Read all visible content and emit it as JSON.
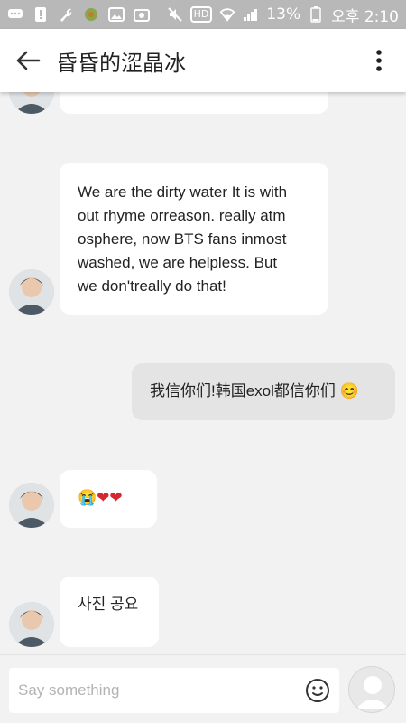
{
  "status_bar": {
    "battery": "13%",
    "time": "오후 2:10",
    "network_badge": "HD"
  },
  "header": {
    "title": "昏昏的涩晶冰"
  },
  "messages": [
    {
      "direction": "in",
      "text": "..."
    },
    {
      "direction": "in",
      "text": "We are the dirty water It is with\nout rhyme orreason. really atm\nosphere, now BTS fans inmost\nwashed, we are helpless. But\nwe don'treally do that!"
    },
    {
      "direction": "out",
      "text": "我信你们!韩国exol都信你们 😊"
    },
    {
      "direction": "in",
      "text": "😭❤❤"
    },
    {
      "direction": "in",
      "text": "사진 공요"
    }
  ],
  "composer": {
    "placeholder": "Say something"
  },
  "icons": {
    "back": "arrow-left-icon",
    "menu": "more-vertical-icon",
    "emoji": "smiley-icon",
    "send_avatar": "user-avatar-icon"
  }
}
